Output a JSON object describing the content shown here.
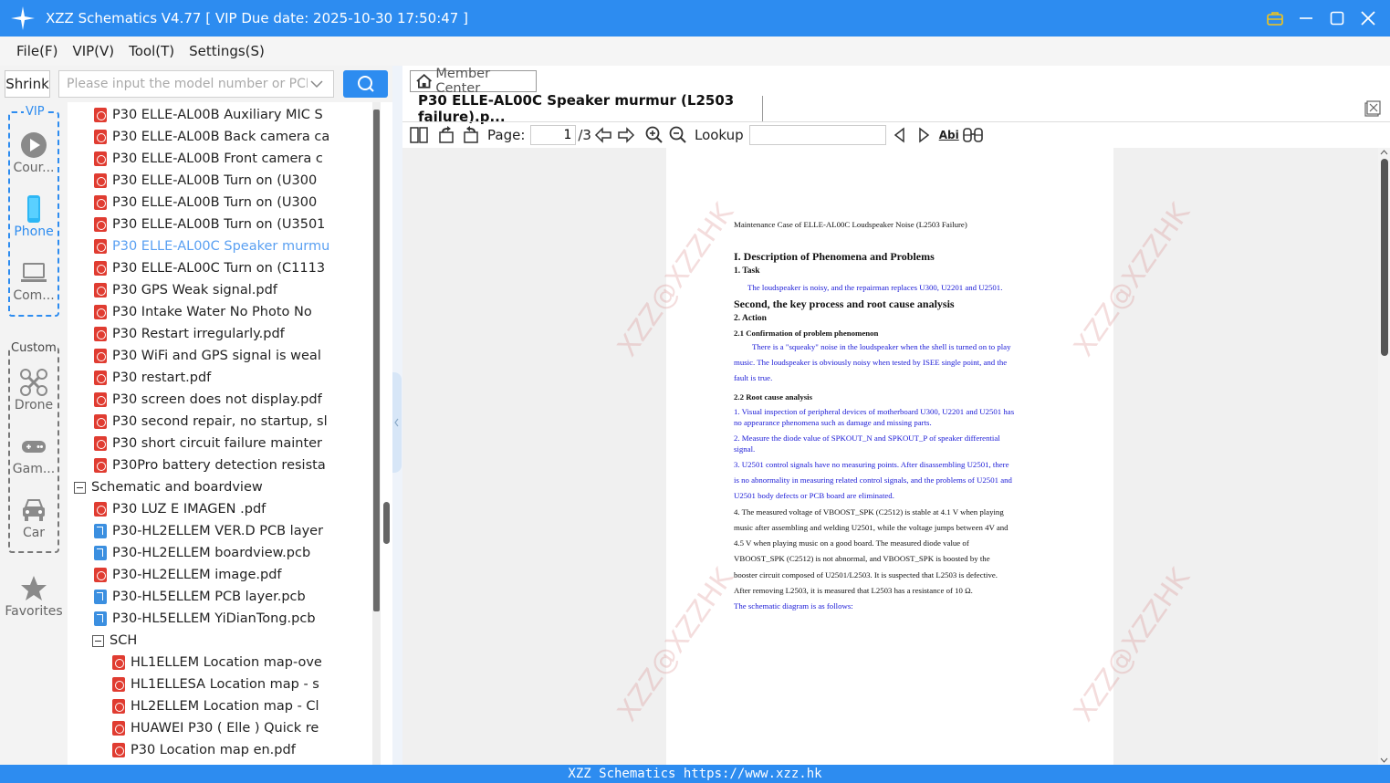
{
  "window": {
    "title": "XZZ Schematics V4.77 [ VIP Due date: 2025-10-30 17:50:47 ]"
  },
  "menu": [
    "File(F)",
    "VIP(V)",
    "Tool(T)",
    "Settings(S)"
  ],
  "toolbar_left": {
    "shrink_label": "Shrink",
    "search_placeholder": "Please input the model number or PCB"
  },
  "sidenav": {
    "vip_label": "VIP",
    "custom_label": "Custom",
    "items": [
      "Cour...",
      "Phone",
      "Com...",
      "Drone",
      "Gam...",
      "Car",
      "Favorites"
    ]
  },
  "tree": {
    "rows": [
      {
        "type": "pdf",
        "indent": 1,
        "text": "P30 ELLE-AL00B Auxiliary MIC S"
      },
      {
        "type": "pdf",
        "indent": 1,
        "text": "P30 ELLE-AL00B Back camera ca"
      },
      {
        "type": "pdf",
        "indent": 1,
        "text": "P30 ELLE-AL00B Front camera c"
      },
      {
        "type": "pdf",
        "indent": 1,
        "text": "P30 ELLE-AL00B Turn on (U300"
      },
      {
        "type": "pdf",
        "indent": 1,
        "text": "P30 ELLE-AL00B Turn on (U300"
      },
      {
        "type": "pdf",
        "indent": 1,
        "text": "P30 ELLE-AL00B Turn on (U3501"
      },
      {
        "type": "pdf",
        "indent": 1,
        "text": "P30 ELLE-AL00C Speaker murmu",
        "selected": true
      },
      {
        "type": "pdf",
        "indent": 1,
        "text": "P30 ELLE-AL00C Turn on (C1113"
      },
      {
        "type": "pdf",
        "indent": 1,
        "text": "P30 GPS Weak signal.pdf"
      },
      {
        "type": "pdf",
        "indent": 1,
        "text": "P30 Intake Water No Photo No"
      },
      {
        "type": "pdf",
        "indent": 1,
        "text": "P30 Restart irregularly.pdf"
      },
      {
        "type": "pdf",
        "indent": 1,
        "text": "P30 WiFi and GPS signal is weal"
      },
      {
        "type": "pdf",
        "indent": 1,
        "text": "P30 restart.pdf"
      },
      {
        "type": "pdf",
        "indent": 1,
        "text": "P30 screen does not display.pdf"
      },
      {
        "type": "pdf",
        "indent": 1,
        "text": "P30 second repair, no startup, sl"
      },
      {
        "type": "pdf",
        "indent": 1,
        "text": "P30 short circuit failure mainter"
      },
      {
        "type": "pdf",
        "indent": 1,
        "text": "P30Pro battery detection resista"
      },
      {
        "type": "folder",
        "indent": 0,
        "text": "Schematic and boardview"
      },
      {
        "type": "pdf",
        "indent": 1,
        "text": "P30 LUZ E IMAGEN .pdf"
      },
      {
        "type": "pcb",
        "indent": 1,
        "text": "P30-HL2ELLEM VER.D PCB layer"
      },
      {
        "type": "pcb",
        "indent": 1,
        "text": "P30-HL2ELLEM boardview.pcb"
      },
      {
        "type": "pdf",
        "indent": 1,
        "text": "P30-HL2ELLEM image.pdf"
      },
      {
        "type": "pcb",
        "indent": 1,
        "text": "P30-HL5ELLEM PCB layer.pcb"
      },
      {
        "type": "pcb",
        "indent": 1,
        "text": "P30-HL5ELLEM YiDianTong.pcb"
      },
      {
        "type": "folder",
        "indent": 1,
        "text": "SCH"
      },
      {
        "type": "pdf",
        "indent": 2,
        "text": "HL1ELLEM Location map-ove"
      },
      {
        "type": "pdf",
        "indent": 2,
        "text": "HL1ELLESA Location map - s"
      },
      {
        "type": "pdf",
        "indent": 2,
        "text": "HL2ELLEM Location map - Cl"
      },
      {
        "type": "pdf",
        "indent": 2,
        "text": "HUAWEI P30 ( Elle ) Quick re"
      },
      {
        "type": "pdf",
        "indent": 2,
        "text": "P30 Location map en.pdf"
      }
    ]
  },
  "viewer": {
    "member_center": "Member Center",
    "tab_title": "P30 ELLE-AL00C Speaker murmur (L2503 failure).p...",
    "page_label": "Page:",
    "page_value": "1",
    "page_total": "/3",
    "lookup_label": "Lookup",
    "abi_label": "Abi"
  },
  "document": {
    "header": "Maintenance Case of ELLE-AL00C Loudspeaker Noise (L2503 Failure)",
    "h1": "I. Description of Phenomena and Problems",
    "s1": "1. Task",
    "task_text": "The loudspeaker is noisy, and the repairman replaces U300, U2201 and U2501.",
    "h2": "Second, the key process and root cause analysis",
    "s2": "2. Action",
    "s21": "2.1  Confirmation of problem phenomenon",
    "p21": [
      "There is a \"squeaky\" noise in the loudspeaker when the shell is turned on to play",
      "music. The loudspeaker is obviously noisy when tested by ISEE single point, and the",
      "fault is true."
    ],
    "s22": "2.2  Root cause analysis",
    "p1": [
      "1. Visual inspection of peripheral devices of motherboard U300, U2201 and U2501 has",
      "no appearance phenomena such as damage and missing parts."
    ],
    "p2": [
      "2. Measure the diode value of SPKOUT_N and SPKOUT_P of speaker differential",
      "signal."
    ],
    "p3": [
      "3. U2501 control signals have no measuring points. After disassembling U2501, there",
      "is no abnormality in measuring related control signals, and the problems of U2501 and",
      "U2501 body defects or PCB board are eliminated."
    ],
    "p4": [
      "4. The measured voltage of VBOOST_SPK (C2512) is stable at 4.1 V when playing",
      "music after assembling and welding U2501, while the voltage jumps between 4V and",
      "4.5 V when playing music on a good board. The measured diode value of",
      "VBOOST_SPK (C2512) is not abnormal, and VBOOST_SPK is boosted by the",
      "booster circuit composed of U2501/L2503. It is suspected that L2503 is defective.",
      "After removing L2503, it is measured that L2503 has a resistance of 10 Ω."
    ],
    "p5": "The schematic diagram is as follows:"
  },
  "statusbar": "XZZ Schematics https://www.xzz.hk"
}
